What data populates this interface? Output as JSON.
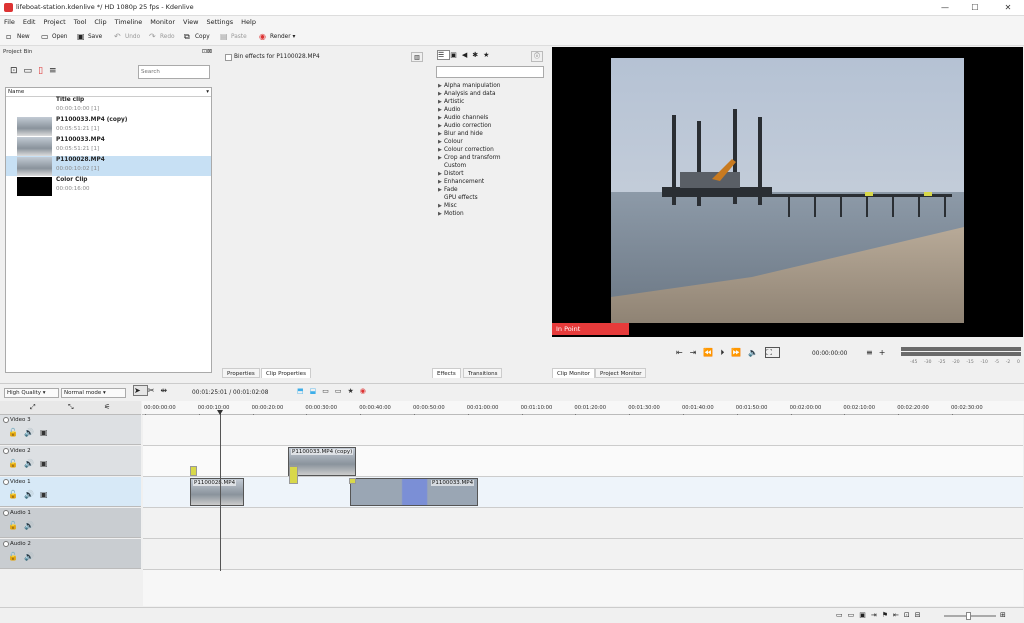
{
  "window": {
    "title": "lifeboat-station.kdenlive */ HD 1080p 25 fps - Kdenlive",
    "min": "—",
    "max": "☐",
    "close": "✕"
  },
  "menu": [
    "File",
    "Edit",
    "Project",
    "Tool",
    "Clip",
    "Timeline",
    "Monitor",
    "View",
    "Settings",
    "Help"
  ],
  "toolbar": {
    "new": "New",
    "open": "Open",
    "save": "Save",
    "undo": "Undo",
    "redo": "Redo",
    "copy": "Copy",
    "paste": "Paste",
    "render": "Render"
  },
  "project_bin": {
    "title": "Project Bin",
    "search_placeholder": "Search",
    "column": "Name",
    "items": [
      {
        "name": "Title clip",
        "duration": "00:00:10:00  [1]"
      },
      {
        "name": "P1100033.MP4 (copy)",
        "duration": "00:05:51:21  [1]"
      },
      {
        "name": "P1100033.MP4",
        "duration": "00:05:51:21  [1]"
      },
      {
        "name": "P1100028.MP4",
        "duration": "00:00:10:02  [1]"
      },
      {
        "name": "Color Clip",
        "duration": "00:00:16:00"
      }
    ]
  },
  "properties": {
    "bin_effects": "Bin effects for P1100028.MP4",
    "tab_properties": "Properties",
    "tab_clip_properties": "Clip Properties"
  },
  "effects": {
    "categories": [
      "Alpha manipulation",
      "Analysis and data",
      "Artistic",
      "Audio",
      "Audio channels",
      "Audio correction",
      "Blur and hide",
      "Colour",
      "Colour correction",
      "Crop and transform",
      "Custom",
      "Distort",
      "Enhancement",
      "Fade",
      "GPU effects",
      "Misc",
      "Motion"
    ],
    "has_arrow": [
      true,
      true,
      true,
      true,
      true,
      true,
      true,
      true,
      true,
      true,
      false,
      true,
      true,
      true,
      false,
      true,
      true
    ],
    "tab_effects": "Effects",
    "tab_transitions": "Transitions"
  },
  "monitor": {
    "in_point": "In Point",
    "timecode": "00:00:00:00",
    "tab_clip": "Clip Monitor",
    "tab_project": "Project Monitor",
    "vu_labels": [
      "-45",
      "-30",
      "-25",
      "-20",
      "-15",
      "-10",
      "-5",
      "-2",
      "0"
    ]
  },
  "timeline_toolbar": {
    "quality": "High Quality",
    "mode": "Normal mode",
    "position": "00:01:25:01",
    "duration": "00:01:02:08"
  },
  "ruler": [
    "00:00:00:00",
    "00:00:10:00",
    "00:00:20:00",
    "00:00:30:00",
    "00:00:40:00",
    "00:00:50:00",
    "00:01:00:00",
    "00:01:10:00",
    "00:01:20:00",
    "00:01:30:00",
    "00:01:40:00",
    "00:01:50:00",
    "00:02:00:00",
    "00:02:10:00",
    "00:02:20:00",
    "00:02:30:00"
  ],
  "tracks": [
    {
      "name": "Video 3",
      "type": "video"
    },
    {
      "name": "Video 2",
      "type": "video"
    },
    {
      "name": "Video 1",
      "type": "video"
    },
    {
      "name": "Audio 1",
      "type": "audio"
    },
    {
      "name": "Audio 2",
      "type": "audio"
    }
  ],
  "clips": [
    {
      "label": "P1100033.MP4 (copy)",
      "track": "Video 2"
    },
    {
      "label": "P1100028.MP4",
      "track": "Video 1"
    },
    {
      "label": "P1100033.MP4",
      "track": "Video 1"
    }
  ],
  "colors": {
    "accent": "#3daee9",
    "selection": "#c7e0f4",
    "in_point": "#e63b3b",
    "video1_bg": "#d7e9f7",
    "clip_marker": "#d8d84a"
  }
}
